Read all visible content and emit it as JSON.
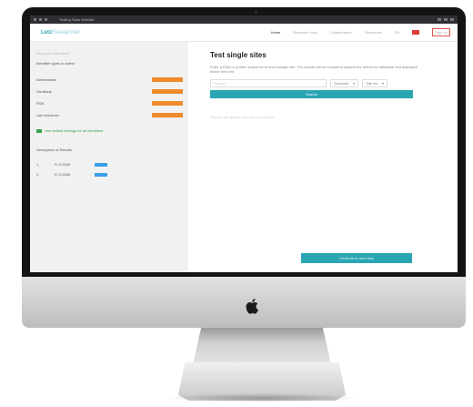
{
  "browser": {
    "title": "Testing Tools Website"
  },
  "brand": {
    "name": "Letz",
    "suffix": "Researcher"
  },
  "nav": {
    "items": [
      "Home",
      "Research tools",
      "Collaborators",
      "Resources",
      "EN"
    ],
    "signup": "Sign up"
  },
  "sidebar": {
    "header": "Sequence identifiers",
    "subheader": "Identifier types to select",
    "rows": [
      "Abbreviation",
      "GenBank",
      "PDB",
      "Lab reference"
    ],
    "check_label": "Use default settings for all identifiers",
    "section": "Description of Results",
    "items": [
      {
        "num": "1.",
        "value": "R 123456"
      },
      {
        "num": "2.",
        "value": "R 123456"
      }
    ]
  },
  "main": {
    "title": "Test single sites",
    "description": "Enter a DNA or protein sequence to test a single site. The results will be compared against the reference database and displayed below the form.",
    "input_placeholder": "Search",
    "select1": "Standard",
    "select2": "Site list",
    "search_button": "Search",
    "note": "Results will appear here once searched",
    "bottom_button": "Continue to next step"
  }
}
